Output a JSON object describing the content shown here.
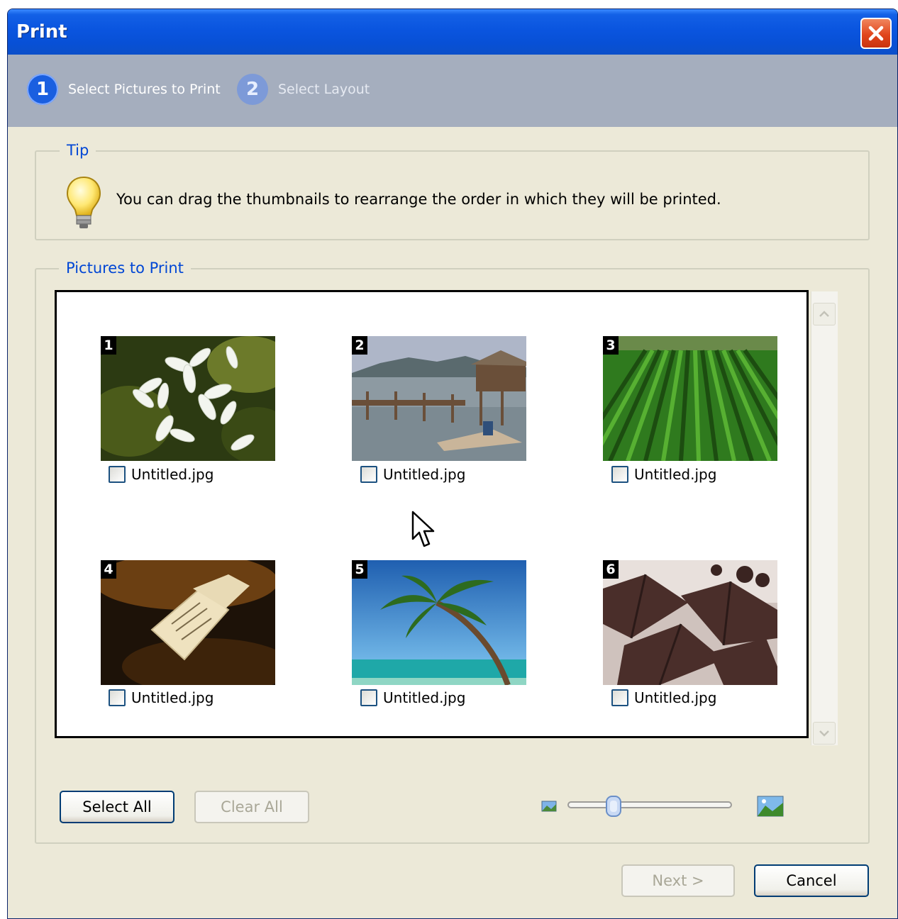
{
  "window": {
    "title": "Print",
    "close_label": "Close"
  },
  "steps": [
    {
      "number": "1",
      "label": "Select Pictures to Print",
      "active": true
    },
    {
      "number": "2",
      "label": "Select Layout",
      "active": false
    }
  ],
  "tip": {
    "legend": "Tip",
    "text": "You can drag the thumbnails to rearrange the order in which they will be printed.",
    "icon": "lightbulb-icon"
  },
  "pictures": {
    "legend": "Pictures to Print",
    "items": [
      {
        "number": "1",
        "filename": "Untitled.jpg",
        "subject": "white flowers",
        "checked": false
      },
      {
        "number": "2",
        "filename": "Untitled.jpg",
        "subject": "stilt houses by water",
        "checked": false
      },
      {
        "number": "3",
        "filename": "Untitled.jpg",
        "subject": "green crop rows",
        "checked": false
      },
      {
        "number": "4",
        "filename": "Untitled.jpg",
        "subject": "paper tag",
        "checked": false
      },
      {
        "number": "5",
        "filename": "Untitled.jpg",
        "subject": "palm tree over sea",
        "checked": false
      },
      {
        "number": "6",
        "filename": "Untitled.jpg",
        "subject": "sepia rooftops",
        "checked": false
      }
    ]
  },
  "buttons": {
    "select_all": "Select All",
    "clear_all": "Clear All",
    "next": "Next >",
    "cancel": "Cancel"
  },
  "zoom_slider": {
    "value": 0.28,
    "min_icon": "small-picture-icon",
    "max_icon": "large-picture-icon"
  },
  "colors": {
    "titlebar": "#0a55df",
    "wizard_bar": "#a5aebe",
    "legend_text": "#0046d5",
    "dialog_bg": "#ece9d8"
  }
}
